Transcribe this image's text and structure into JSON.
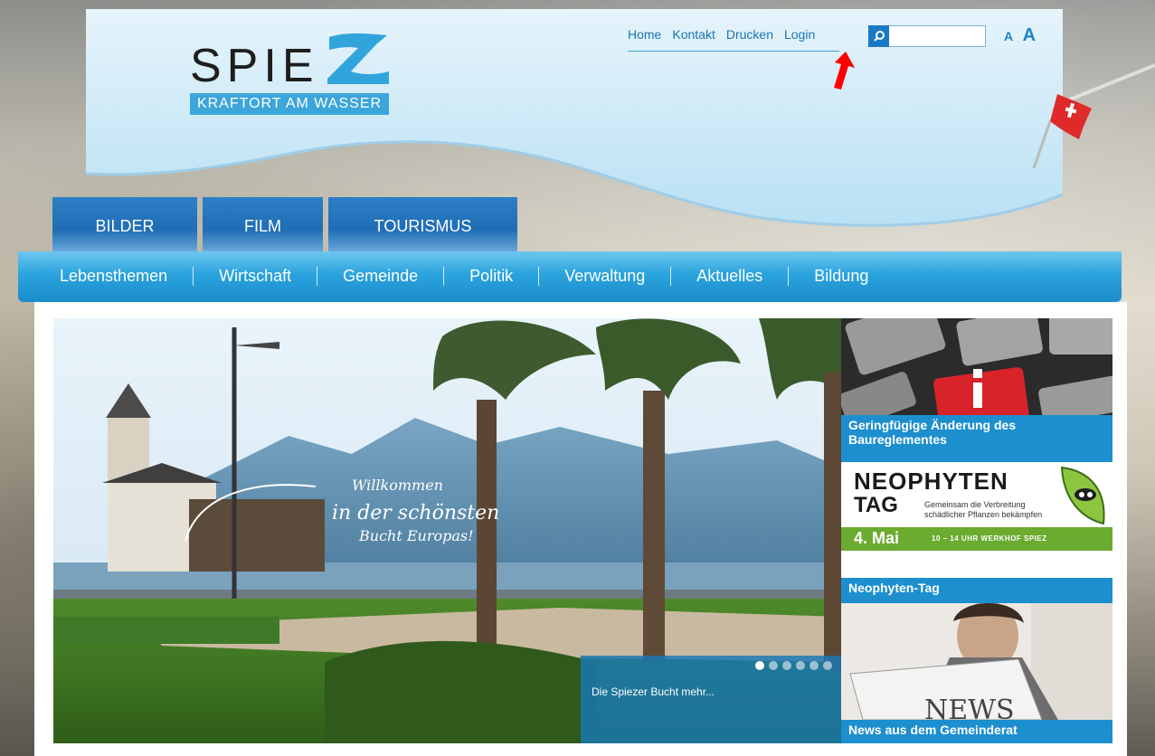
{
  "logo": {
    "word": "SPIE",
    "tagline": "KRAFTORT AM WASSER"
  },
  "topnav": [
    "Home",
    "Kontakt",
    "Drucken",
    "Login"
  ],
  "search": {
    "placeholder": ""
  },
  "font_size": {
    "small": "A",
    "large": "A"
  },
  "tabs": [
    "BILDER",
    "FILM",
    "TOURISMUS"
  ],
  "mainnav": [
    "Lebensthemen",
    "Wirtschaft",
    "Gemeinde",
    "Politik",
    "Verwaltung",
    "Aktuelles",
    "Bildung"
  ],
  "hero": {
    "overlay_line1": "Willkommen",
    "overlay_line2": "in der schönsten",
    "overlay_line3": "Bucht Europas!",
    "caption": "Die Spiezer Bucht mehr...",
    "dots_total": 6,
    "dot_active": 1
  },
  "side": {
    "card1": "Geringfügige Änderung des Baureglementes",
    "neo_title1": "NEOPHYTEN",
    "neo_title2": "TAG",
    "neo_sub": "Gemeinsam die Verbreitung schädlicher Pflanzen bekämpfen",
    "neo_date": "4. Mai",
    "neo_time": "10 – 14 UHR   WERKHOF SPIEZ",
    "card2": "Neophyten-Tag",
    "news_word": "NEWS",
    "card3": "News aus dem Gemeinderat"
  },
  "colors": {
    "accent": "#1d8fcf",
    "nav": "#2aa3dd",
    "tab": "#1f6db6",
    "arrow": "#ff0000",
    "neo_green": "#6bab2f"
  }
}
